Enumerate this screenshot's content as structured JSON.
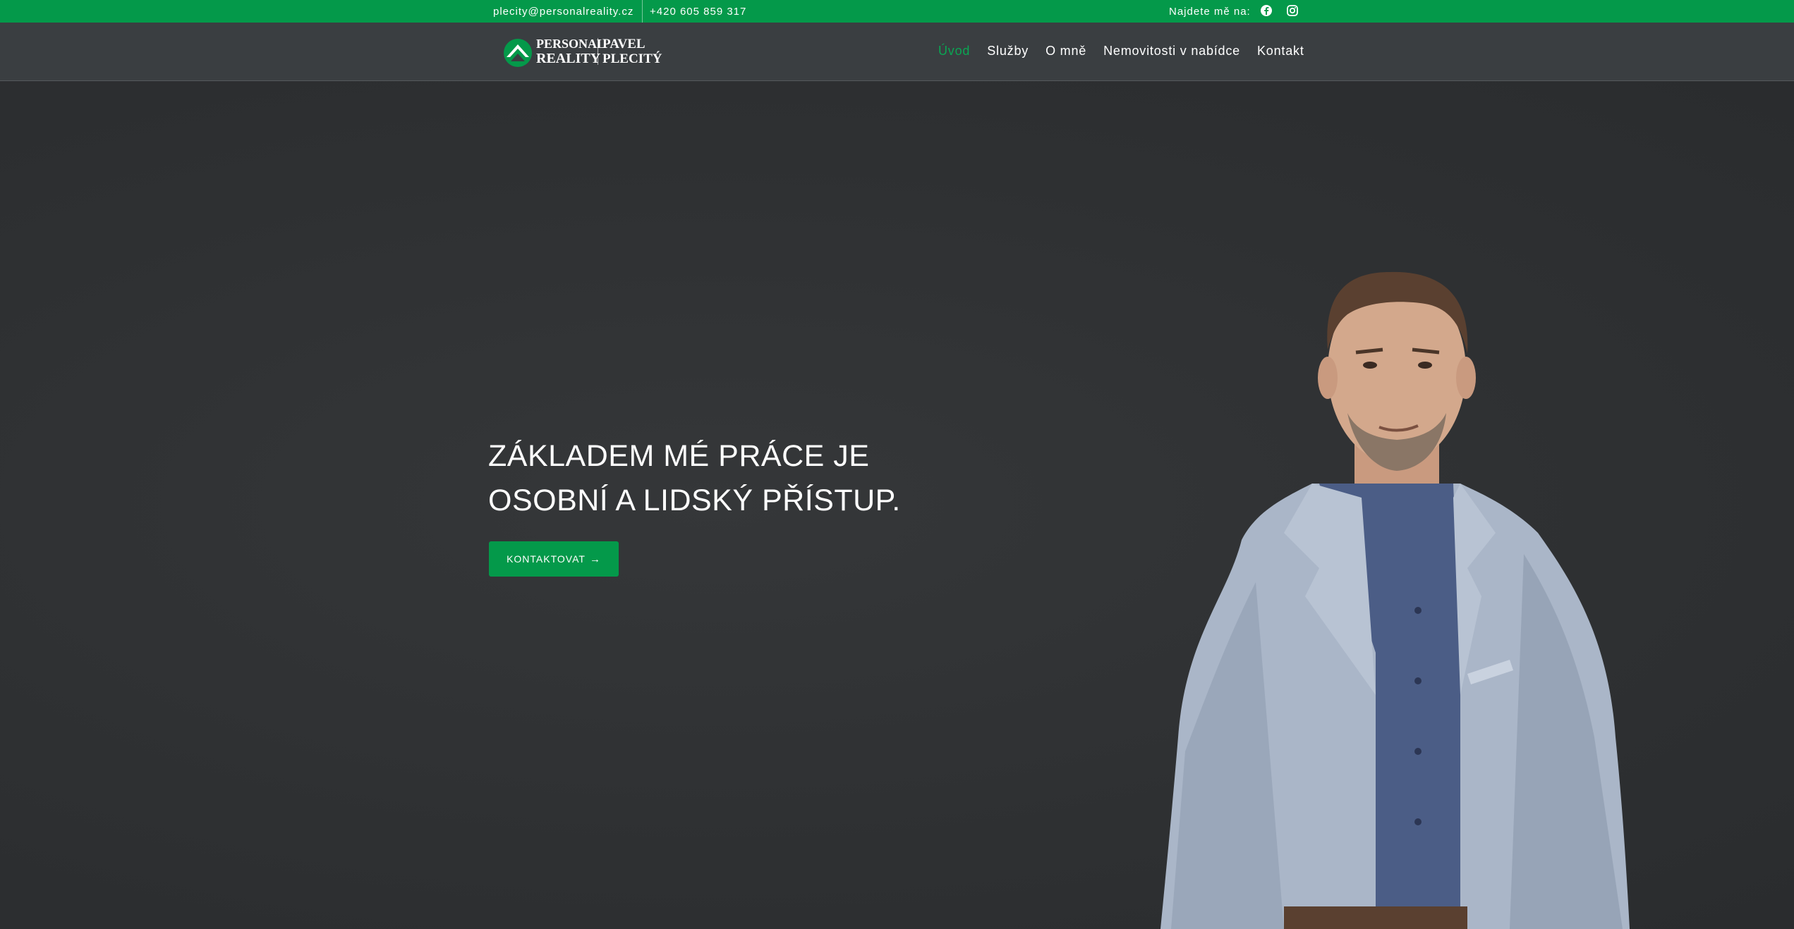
{
  "topbar": {
    "email": "plecity@personalreality.cz",
    "phone": "+420 605 859 317",
    "find_me": "Najdete mě na:",
    "social": [
      "facebook-icon",
      "instagram-icon"
    ]
  },
  "logo": {
    "line1": "PERSONAL",
    "line2": "REALITY",
    "name1": "PAVEL",
    "name2": "PLECITÝ"
  },
  "nav": {
    "items": [
      "Úvod",
      "Služby",
      "O mně",
      "Nemovitosti v nabídce",
      "Kontakt"
    ],
    "active": "Úvod"
  },
  "hero": {
    "headline_line1": "ZÁKLADEM MÉ PRÁCE JE",
    "headline_line2": "OSOBNÍ A LIDSKÝ PŘÍSTUP.",
    "cta_label": "KONTAKTOVAT"
  },
  "colors": {
    "brand_green": "#04994a",
    "header_bg": "#3a3e41",
    "hero_bg": "#2f3133"
  }
}
